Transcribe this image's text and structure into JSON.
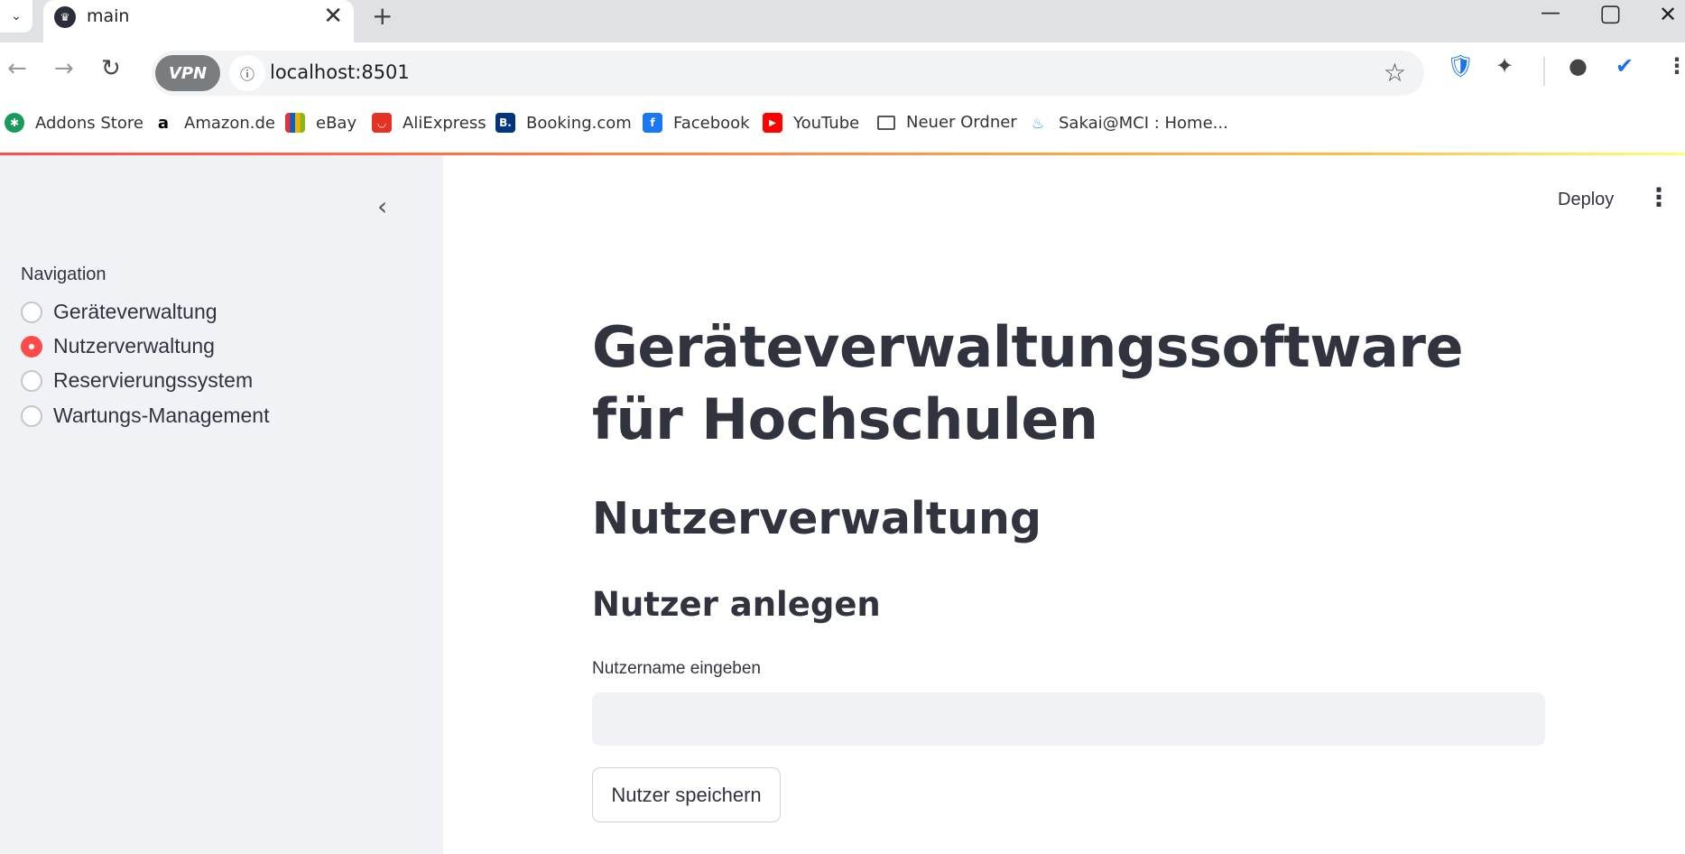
{
  "browser": {
    "tab_title": "main",
    "url": "localhost:8501",
    "vpn_label": "VPN",
    "bookmarks": [
      {
        "label": "Addons Store",
        "icon": "addons-store-icon",
        "color": "#1a9a5a"
      },
      {
        "label": "Amazon.de",
        "icon": "amazon-icon",
        "color": "#000000"
      },
      {
        "label": "eBay",
        "icon": "ebay-icon",
        "color": "#e53238"
      },
      {
        "label": "AliExpress",
        "icon": "aliexpress-icon",
        "color": "#e43225"
      },
      {
        "label": "Booking.com",
        "icon": "booking-icon",
        "color": "#003580"
      },
      {
        "label": "Facebook",
        "icon": "facebook-icon",
        "color": "#1877f2"
      },
      {
        "label": "YouTube",
        "icon": "youtube-icon",
        "color": "#ff0000"
      },
      {
        "label": "Neuer Ordner",
        "icon": "folder-icon",
        "color": "#555555"
      },
      {
        "label": "Sakai@MCI : Home...",
        "icon": "sakai-icon",
        "color": "#4aa3df"
      }
    ]
  },
  "sidebar": {
    "nav_label": "Navigation",
    "items": [
      {
        "label": "Geräteverwaltung",
        "selected": false
      },
      {
        "label": "Nutzerverwaltung",
        "selected": true
      },
      {
        "label": "Reservierungssystem",
        "selected": false
      },
      {
        "label": "Wartungs-Management",
        "selected": false
      }
    ]
  },
  "header": {
    "deploy_label": "Deploy"
  },
  "main": {
    "title": "Geräteverwaltungssoftware für Hochschulen",
    "section_title": "Nutzerverwaltung",
    "subsection_title": "Nutzer anlegen",
    "username_label": "Nutzername eingeben",
    "username_value": "",
    "save_button": "Nutzer speichern"
  },
  "colors": {
    "accent": "#ff4b4b",
    "sidebar_bg": "#f0f2f6",
    "text": "#31333f"
  }
}
